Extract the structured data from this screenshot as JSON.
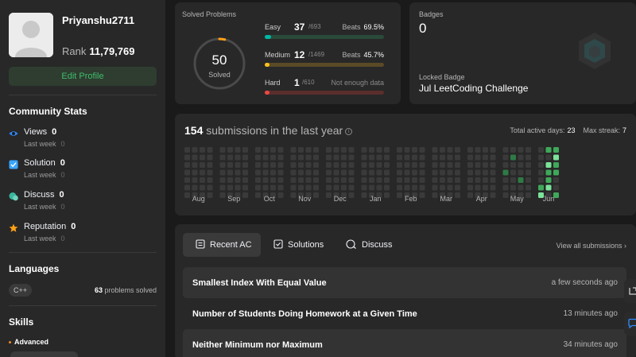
{
  "profile": {
    "username": "Priyanshu2711",
    "rank_label": "Rank",
    "rank_value": "11,79,769",
    "edit_button": "Edit Profile"
  },
  "community": {
    "title": "Community Stats",
    "stats": [
      {
        "name": "Views",
        "value": "0",
        "sub_label": "Last week",
        "sub_value": "0",
        "icon": "eye-icon",
        "color": "#2e8bff"
      },
      {
        "name": "Solution",
        "value": "0",
        "sub_label": "Last week",
        "sub_value": "0",
        "icon": "checkbox-icon",
        "color": "#3aa6ff"
      },
      {
        "name": "Discuss",
        "value": "0",
        "sub_label": "Last week",
        "sub_value": "0",
        "icon": "chat-icon",
        "color": "#38b79e"
      },
      {
        "name": "Reputation",
        "value": "0",
        "sub_label": "Last week",
        "sub_value": "0",
        "icon": "star-icon",
        "color": "#ffa116"
      }
    ]
  },
  "languages": {
    "title": "Languages",
    "items": [
      {
        "name": "C++",
        "count": "63",
        "suffix": "problems solved"
      }
    ]
  },
  "skills": {
    "title": "Skills",
    "level": "Advanced"
  },
  "solved": {
    "label": "Solved Problems",
    "total": "50",
    "total_label": "Solved",
    "progress_fraction": 0.035,
    "difficulties": [
      {
        "name": "Easy",
        "count": "37",
        "total": "/693",
        "beats_label": "Beats",
        "beats_value": "69.5%",
        "fraction": 0.053,
        "color": "#00b8a3",
        "track": "#2a4a3a"
      },
      {
        "name": "Medium",
        "count": "12",
        "total": "/1469",
        "beats_label": "Beats",
        "beats_value": "45.7%",
        "fraction": 0.008,
        "color": "#ffc01e",
        "track": "#5a4a26"
      },
      {
        "name": "Hard",
        "count": "1",
        "total": "/610",
        "beats_label": "",
        "beats_value": "Not enough data",
        "fraction": 0.002,
        "color": "#ef4743",
        "track": "#5a2e2c"
      }
    ]
  },
  "badges": {
    "label": "Badges",
    "count": "0",
    "locked_label": "Locked Badge",
    "locked_name": "Jul LeetCoding Challenge"
  },
  "heatmap": {
    "count": "154",
    "title_rest": "submissions in the last year",
    "active_label": "Total active days:",
    "active_value": "23",
    "streak_label": "Max streak:",
    "streak_value": "7",
    "months": [
      "Aug",
      "Sep",
      "Oct",
      "Nov",
      "Dec",
      "Jan",
      "Feb",
      "Mar",
      "Apr",
      "May",
      "Jun"
    ]
  },
  "recent": {
    "tabs": [
      {
        "label": "Recent AC",
        "icon": "list-icon",
        "active": true
      },
      {
        "label": "Solutions",
        "icon": "solution-icon",
        "active": false
      },
      {
        "label": "Discuss",
        "icon": "discuss-icon",
        "active": false
      }
    ],
    "view_all": "View all submissions",
    "rows": [
      {
        "title": "Smallest Index With Equal Value",
        "time": "a few seconds ago"
      },
      {
        "title": "Number of Students Doing Homework at a Given Time",
        "time": "13 minutes ago"
      },
      {
        "title": "Neither Minimum nor Maximum",
        "time": "34 minutes ago"
      }
    ]
  }
}
